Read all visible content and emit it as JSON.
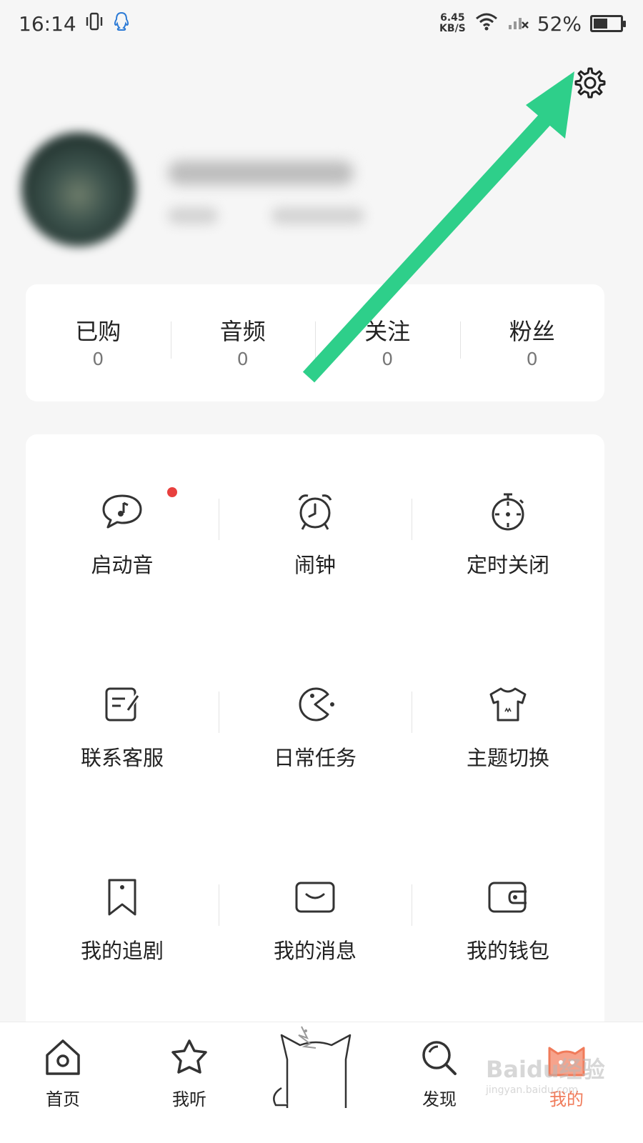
{
  "status_bar": {
    "time": "16:14",
    "net_speed_value": "6.45",
    "net_speed_unit": "KB/S",
    "battery_text": "52%",
    "battery_level": 0.52,
    "icons": [
      "vibrate-icon",
      "qq-icon",
      "wifi-icon",
      "no-signal-icon",
      "battery-icon"
    ]
  },
  "stats": [
    {
      "label": "已购",
      "value": "0"
    },
    {
      "label": "音频",
      "value": "0"
    },
    {
      "label": "关注",
      "value": "0"
    },
    {
      "label": "粉丝",
      "value": "0"
    }
  ],
  "menu": [
    {
      "label": "启动音",
      "icon": "music-bubble-icon",
      "badge": true
    },
    {
      "label": "闹钟",
      "icon": "alarm-clock-icon"
    },
    {
      "label": "定时关闭",
      "icon": "timer-icon"
    },
    {
      "label": "联系客服",
      "icon": "edit-note-icon"
    },
    {
      "label": "日常任务",
      "icon": "pacman-icon"
    },
    {
      "label": "主题切换",
      "icon": "tshirt-icon"
    },
    {
      "label": "我的追剧",
      "icon": "bookmark-icon"
    },
    {
      "label": "我的消息",
      "icon": "message-icon"
    },
    {
      "label": "我的钱包",
      "icon": "wallet-icon"
    }
  ],
  "tabs": [
    {
      "label": "首页",
      "icon": "home-icon"
    },
    {
      "label": "我听",
      "icon": "star-icon"
    },
    {
      "label": "发现",
      "icon": "discover-search-icon"
    },
    {
      "label": "我的",
      "icon": "cat-face-icon",
      "active": true
    }
  ],
  "colors": {
    "accent": "#f07b5a",
    "badge": "#e8403e",
    "annotation_arrow": "#2ecf8a"
  },
  "watermark": {
    "main": "Baidu经验",
    "sub": "jingyan.baidu.com"
  }
}
